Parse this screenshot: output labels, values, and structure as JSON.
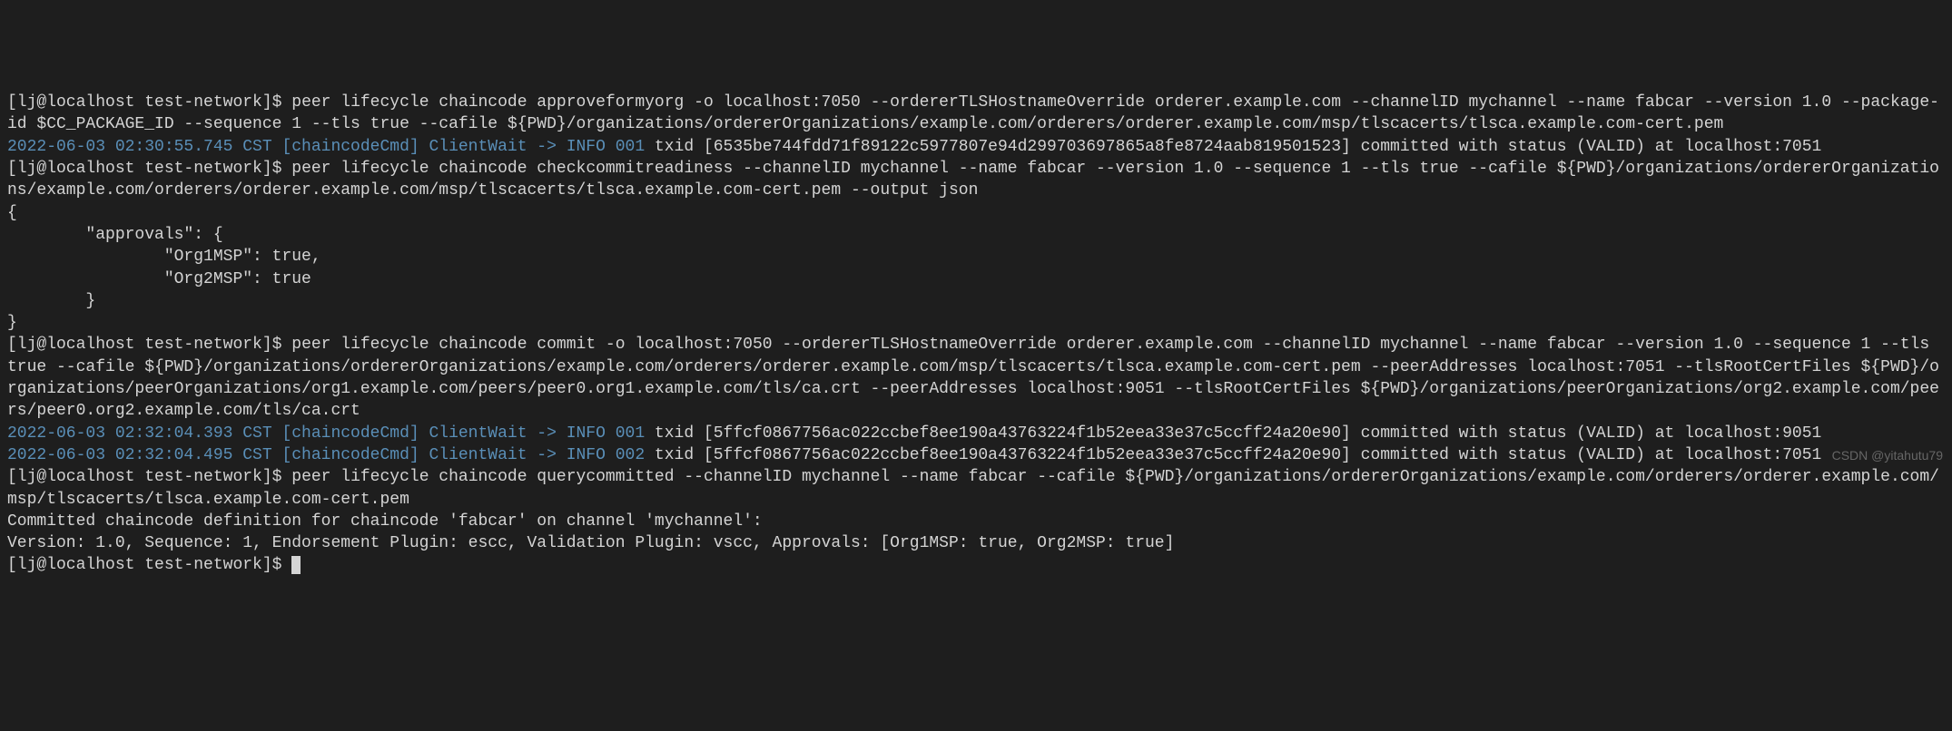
{
  "prompt": "[lj@localhost test-network]$ ",
  "cmd1": "peer lifecycle chaincode approveformyorg -o localhost:7050 --ordererTLSHostnameOverride orderer.example.com --channelID mychannel --name fabcar --version 1.0 --package-id $CC_PACKAGE_ID --sequence 1 --tls true --cafile ${PWD}/organizations/ordererOrganizations/example.com/orderers/orderer.example.com/msp/tlscacerts/tlsca.example.com-cert.pem",
  "log1_ts": "2022-06-03 02:30:55.745 CST [chaincodeCmd] ClientWait -> INFO 001",
  "log1_body": " txid [6535be744fdd71f89122c5977807e94d299703697865a8fe8724aab819501523] committed with status (VALID) at localhost:7051",
  "cmd2": "peer lifecycle chaincode checkcommitreadiness --channelID mychannel --name fabcar --version 1.0 --sequence 1 --tls true --cafile ${PWD}/organizations/ordererOrganizations/example.com/orderers/orderer.example.com/msp/tlscacerts/tlsca.example.com-cert.pem --output json",
  "json_open": "{",
  "json_approvals_key": "        \"approvals\": {",
  "json_org1": "                \"Org1MSP\": true,",
  "json_org2": "                \"Org2MSP\": true",
  "json_approvals_close": "        }",
  "json_close": "}",
  "cmd3": "peer lifecycle chaincode commit -o localhost:7050 --ordererTLSHostnameOverride orderer.example.com --channelID mychannel --name fabcar --version 1.0 --sequence 1 --tls true --cafile ${PWD}/organizations/ordererOrganizations/example.com/orderers/orderer.example.com/msp/tlscacerts/tlsca.example.com-cert.pem --peerAddresses localhost:7051 --tlsRootCertFiles ${PWD}/organizations/peerOrganizations/org1.example.com/peers/peer0.org1.example.com/tls/ca.crt --peerAddresses localhost:9051 --tlsRootCertFiles ${PWD}/organizations/peerOrganizations/org2.example.com/peers/peer0.org2.example.com/tls/ca.crt",
  "log2_ts": "2022-06-03 02:32:04.393 CST [chaincodeCmd] ClientWait -> INFO 001",
  "log2_body": " txid [5ffcf0867756ac022ccbef8ee190a43763224f1b52eea33e37c5ccff24a20e90] committed with status (VALID) at localhost:9051",
  "log3_ts": "2022-06-03 02:32:04.495 CST [chaincodeCmd] ClientWait -> INFO 002",
  "log3_body": " txid [5ffcf0867756ac022ccbef8ee190a43763224f1b52eea33e37c5ccff24a20e90] committed with status (VALID) at localhost:7051",
  "cmd4": "peer lifecycle chaincode querycommitted --channelID mychannel --name fabcar --cafile ${PWD}/organizations/ordererOrganizations/example.com/orderers/orderer.example.com/msp/tlscacerts/tlsca.example.com-cert.pem",
  "out1": "Committed chaincode definition for chaincode 'fabcar' on channel 'mychannel':",
  "out2": "Version: 1.0, Sequence: 1, Endorsement Plugin: escc, Validation Plugin: vscc, Approvals: [Org1MSP: true, Org2MSP: true]",
  "watermark": "CSDN @yitahutu79"
}
